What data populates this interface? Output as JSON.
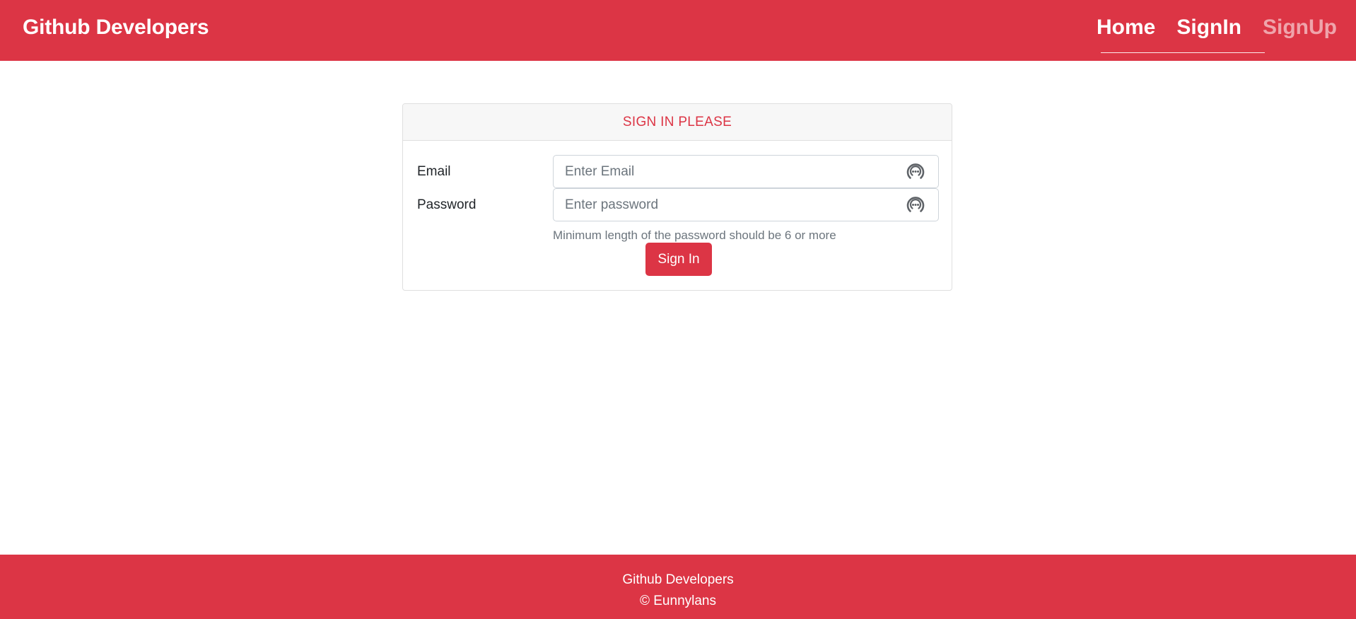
{
  "navbar": {
    "brand": "Github Developers",
    "links": [
      {
        "label": "Home",
        "active": true
      },
      {
        "label": "SignIn",
        "active": true
      },
      {
        "label": "SignUp",
        "active": false
      }
    ],
    "background_color": "#dc3545"
  },
  "signin_card": {
    "header": "SIGN IN PLEASE",
    "email": {
      "label": "Email",
      "placeholder": "Enter Email",
      "value": "",
      "icon": "password-manager-icon"
    },
    "password": {
      "label": "Password",
      "placeholder": "Enter password",
      "value": "",
      "icon": "password-manager-icon"
    },
    "help_text": "Minimum length of the password should be 6 or more",
    "submit_label": "Sign In"
  },
  "footer": {
    "line1": "Github Developers",
    "line2": "© Eunnylans"
  },
  "colors": {
    "primary": "#dc3545",
    "card_header_bg": "#f7f7f7",
    "muted_text": "#6c757d"
  }
}
